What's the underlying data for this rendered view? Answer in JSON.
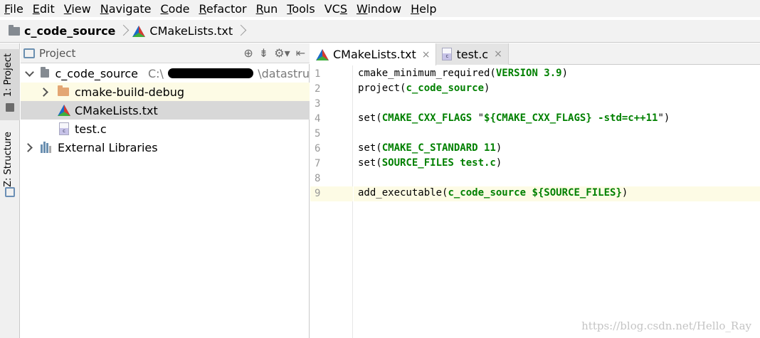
{
  "menu": {
    "items": [
      "File",
      "Edit",
      "View",
      "Navigate",
      "Code",
      "Refactor",
      "Run",
      "Tools",
      "VCS",
      "Window",
      "Help"
    ],
    "mnemonic_index": [
      0,
      0,
      0,
      0,
      0,
      0,
      0,
      0,
      2,
      0,
      0
    ]
  },
  "breadcrumb": {
    "project": "c_code_source",
    "file": "CMakeLists.txt"
  },
  "left_strip": {
    "project_label": "1: Project",
    "structure_label": "Z: Structure"
  },
  "project_panel": {
    "title": "Project",
    "tree": {
      "root_name": "c_code_source",
      "root_path_prefix": "C:\\",
      "root_path_suffix": "\\datastru",
      "items": [
        {
          "name": "cmake-build-debug"
        },
        {
          "name": "CMakeLists.txt"
        },
        {
          "name": "test.c"
        }
      ],
      "external": "External Libraries"
    }
  },
  "editor": {
    "tabs": [
      {
        "label": "CMakeLists.txt",
        "close": "×",
        "active": true
      },
      {
        "label": "test.c",
        "close": "×",
        "active": false
      }
    ],
    "current_line": 9,
    "lines": [
      {
        "n": "1"
      },
      {
        "n": "2"
      },
      {
        "n": "3"
      },
      {
        "n": "4"
      },
      {
        "n": "5"
      },
      {
        "n": "6"
      },
      {
        "n": "7"
      },
      {
        "n": "8"
      },
      {
        "n": "9"
      }
    ],
    "code": {
      "l1a": "cmake_minimum_required(",
      "l1b": "VERSION 3.9",
      "l1c": ")",
      "l2a": "project(",
      "l2b": "c_code_source",
      "l2c": ")",
      "l4a": "set(",
      "l4b": "CMAKE_CXX_FLAGS",
      "l4c": " \"",
      "l4d": "${CMAKE_CXX_FLAGS} -std=c++11",
      "l4e": "\")",
      "l6a": "set(",
      "l6b": "CMAKE_C_STANDARD 11",
      "l6c": ")",
      "l7a": "set(",
      "l7b": "SOURCE_FILES test.c",
      "l7c": ")",
      "l9a": "add_executable(",
      "l9b": "c_code_source ${SOURCE_FILES}",
      "l9c": ")"
    }
  },
  "watermark": "https://blog.csdn.net/Hello_Ray",
  "colors": {
    "keyword": "#008000",
    "current_line": "#fdfbe5",
    "selected_row": "#d8d8d8",
    "folder_gray": "#848a91",
    "folder_orange": "#e3a673"
  }
}
